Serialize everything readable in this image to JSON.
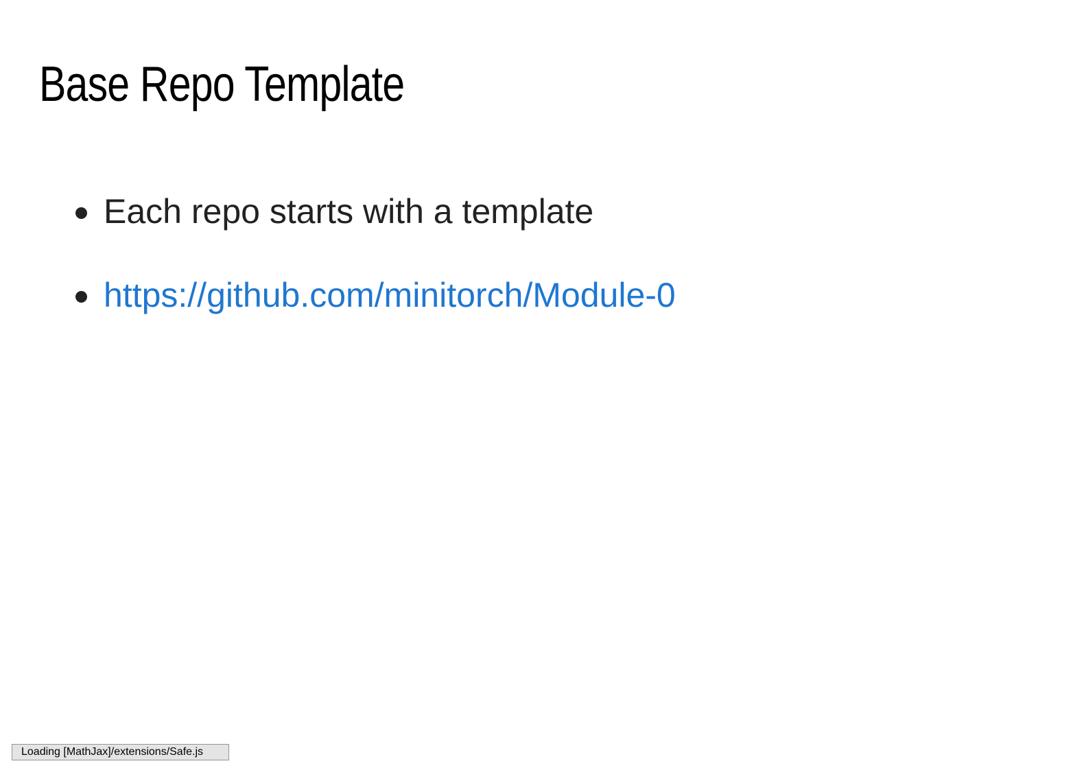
{
  "slide": {
    "title": "Base Repo Template",
    "bullets": [
      {
        "text": "Each repo starts with a template"
      },
      {
        "text": "https://github.com/minitorch/Module-0",
        "link_color": "#1f77d0"
      }
    ]
  },
  "status": {
    "text": "Loading [MathJax]/extensions/Safe.js"
  }
}
